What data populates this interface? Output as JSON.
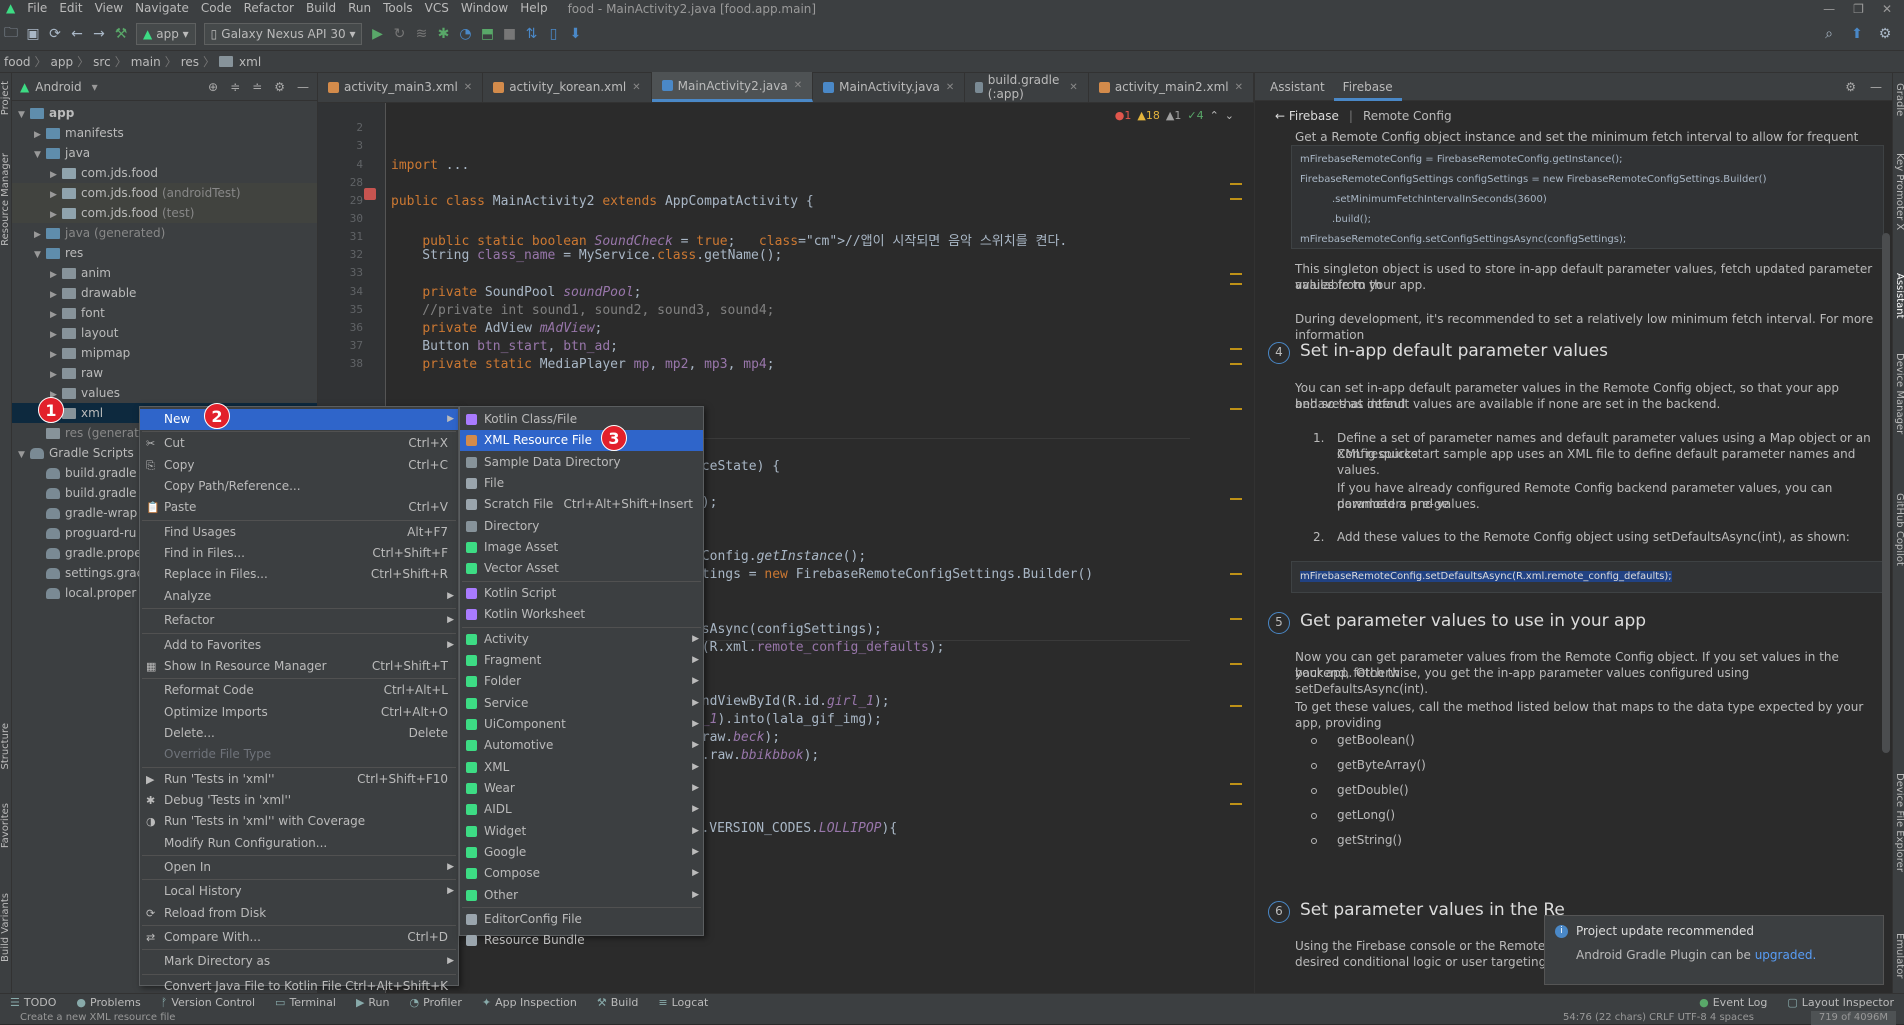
{
  "menubar": {
    "items": [
      "File",
      "Edit",
      "View",
      "Navigate",
      "Code",
      "Refactor",
      "Build",
      "Run",
      "Tools",
      "VCS",
      "Window",
      "Help"
    ],
    "title": "food - MainActivity2.java [food.app.main]"
  },
  "toolbar": {
    "config": "app",
    "device": "Galaxy Nexus API 30"
  },
  "breadcrumb": [
    "food",
    "app",
    "src",
    "main",
    "res",
    "xml"
  ],
  "project": {
    "view": "Android",
    "tree": [
      {
        "label": "app",
        "depth": 0,
        "arrow": "▼",
        "icon": "folder-blue",
        "bold": true
      },
      {
        "label": "manifests",
        "depth": 1,
        "arrow": "▶",
        "icon": "folder-blue"
      },
      {
        "label": "java",
        "depth": 1,
        "arrow": "▼",
        "icon": "folder-blue"
      },
      {
        "label": "com.jds.food",
        "depth": 2,
        "arrow": "▶",
        "icon": "pkg"
      },
      {
        "label": "com.jds.food",
        "suffix": "(androidTest)",
        "depth": 2,
        "arrow": "▶",
        "icon": "pkg",
        "hl": true
      },
      {
        "label": "com.jds.food",
        "suffix": "(test)",
        "depth": 2,
        "arrow": "▶",
        "icon": "pkg",
        "hl": true
      },
      {
        "label": "java (generated)",
        "depth": 1,
        "arrow": "▶",
        "icon": "folder-blue",
        "dim": true
      },
      {
        "label": "res",
        "depth": 1,
        "arrow": "▼",
        "icon": "folder-blue"
      },
      {
        "label": "anim",
        "depth": 2,
        "arrow": "▶",
        "icon": "folder"
      },
      {
        "label": "drawable",
        "depth": 2,
        "arrow": "▶",
        "icon": "folder"
      },
      {
        "label": "font",
        "depth": 2,
        "arrow": "▶",
        "icon": "folder"
      },
      {
        "label": "layout",
        "depth": 2,
        "arrow": "▶",
        "icon": "folder"
      },
      {
        "label": "mipmap",
        "depth": 2,
        "arrow": "▶",
        "icon": "folder"
      },
      {
        "label": "raw",
        "depth": 2,
        "arrow": "▶",
        "icon": "folder"
      },
      {
        "label": "values",
        "depth": 2,
        "arrow": "▶",
        "icon": "folder"
      },
      {
        "label": "xml",
        "depth": 2,
        "arrow": "▶",
        "icon": "folder",
        "sel": true
      },
      {
        "label": "res (generat",
        "depth": 1,
        "arrow": "",
        "icon": "folder",
        "dim": true
      },
      {
        "label": "Gradle Scripts",
        "depth": 0,
        "arrow": "▼",
        "icon": "gradle"
      },
      {
        "label": "build.gradle",
        "depth": 1,
        "arrow": "",
        "icon": "gradle"
      },
      {
        "label": "build.gradle",
        "depth": 1,
        "arrow": "",
        "icon": "gradle"
      },
      {
        "label": "gradle-wrap",
        "depth": 1,
        "arrow": "",
        "icon": "gradle"
      },
      {
        "label": "proguard-ru",
        "depth": 1,
        "arrow": "",
        "icon": "gradle"
      },
      {
        "label": "gradle.prope",
        "depth": 1,
        "arrow": "",
        "icon": "gradle"
      },
      {
        "label": "settings.grac",
        "depth": 1,
        "arrow": "",
        "icon": "gradle"
      },
      {
        "label": "local.proper",
        "depth": 1,
        "arrow": "",
        "icon": "gradle"
      }
    ]
  },
  "editor_tabs": [
    {
      "label": "activity_main3.xml",
      "color": "#d38b4b"
    },
    {
      "label": "activity_korean.xml",
      "color": "#d38b4b"
    },
    {
      "label": "MainActivity2.java",
      "color": "#4a88c7",
      "active": true
    },
    {
      "label": "MainActivity.java",
      "color": "#4a88c7"
    },
    {
      "label": "build.gradle (:app)",
      "color": "#7a8a94"
    },
    {
      "label": "activity_main2.xml",
      "color": "#d38b4b"
    }
  ],
  "inspections": {
    "errors": "1",
    "warnings": "18",
    "weak": "1",
    "ok": "4"
  },
  "line_numbers": [
    "2",
    "3",
    "4",
    "28",
    "29",
    "30",
    "31",
    "32",
    "33",
    "34",
    "35",
    "36",
    "37",
    "38"
  ],
  "code_lines": [
    {
      "text": "import ..."
    },
    {
      "text": "public class MainActivity2 extends AppCompatActivity {"
    },
    {
      "text": "    public static boolean SoundCheck = true;   //앱이 시작되면 음악 스위치를 켠다."
    },
    {
      "text": "    String class_name = MyService.class.getName();"
    },
    {
      "text": "    private SoundPool soundPool;"
    },
    {
      "text": "    //private int sound1, sound2, sound3, sound4;"
    },
    {
      "text": "    private AdView mAdView;"
    },
    {
      "text": "    Button btn_start, btn_ad;"
    },
    {
      "text": "    private static MediaPlayer mp, mp2, mp3, mp4;"
    },
    {
      "text": "Config;"
    },
    {
      "text": "dInstanceState) {"
    },
    {
      "text": "te);"
    },
    {
      "text": "y_main2);"
    },
    {
      "text": "eRemoteConfig.getInstance();"
    },
    {
      "text": "nfigSettings = new FirebaseRemoteConfigSettings.Builder()"
    },
    {
      "text": "SettingsAsync(configSettings);"
    },
    {
      "text": "tsAsync(R.xml.remote_config_defaults);"
    },
    {
      "text": "View)findViewById(R.id.girl_1);"
    },
    {
      "text": "raw.two_1).into(lala_gif_img);"
    },
    {
      "text": "this,R.raw.beck);"
    },
    {
      "text": " this,R.raw.bbikbbok);"
    },
    {
      "text": "f(Build.VERSION.SDK_INT >= Build.VERSION_CODES.LOLLIPOP){"
    }
  ],
  "assistant": {
    "tabs": [
      "Assistant",
      "Firebase"
    ],
    "back_label": "← Firebase",
    "nav_current": "Remote Config",
    "intro": "Get a Remote Config object instance and set the minimum fetch interval to allow for frequent refreshes:",
    "code1": [
      "mFirebaseRemoteConfig = FirebaseRemoteConfig.getInstance();",
      "FirebaseRemoteConfigSettings configSettings = new FirebaseRemoteConfigSettings.Builder()",
      ".setMinimumFetchIntervalInSeconds(3600)",
      ".build();",
      "mFirebaseRemoteConfig.setConfigSettingsAsync(configSettings);"
    ],
    "p1": "This singleton object is used to store in-app default parameter values, fetch updated parameter values from th",
    "p1b": "available to your app.",
    "p2": "During development, it's recommended to set a relatively low minimum fetch interval. For more information",
    "step4_num": "4",
    "step4_title": "Set in-app default parameter values",
    "p3": "You can set in-app default parameter values in the Remote Config object, so that your app behaves as intend",
    "p3b": "and so that default values are available if none are set in the backend.",
    "li1_num": "1.",
    "li1": "Define a set of parameter names and default parameter values using a Map object or an XML resource",
    "li1b": "Config quickstart sample app uses an XML file to define default parameter names and values.",
    "li1c": "If you have already configured Remote Config backend parameter values, you can download a pre-ge",
    "li1d": "parameters and values.",
    "li2_num": "2.",
    "li2": "Add these values to the Remote Config object using setDefaultsAsync(int), as shown:",
    "code2": "mFirebaseRemoteConfig.setDefaultsAsync(R.xml.remote_config_defaults);",
    "step5_num": "5",
    "step5_title": "Get parameter values to use in your app",
    "p4": "Now you can get parameter values from the Remote Config object. If you set values in the backend, fetch th",
    "p4b": "your app. Otherwise, you get the in-app parameter values configured using setDefaultsAsync(int).",
    "p5": "To get these values, call the method listed below that maps to the data type expected by your app, providing",
    "methods": [
      "getBoolean()",
      "getByteArray()",
      "getDouble()",
      "getLong()",
      "getString()"
    ],
    "step6_num": "6",
    "step6_title": "Set parameter values in the Re",
    "p6": "Using the Firebase console or the Remote Cor",
    "p6b": "desired conditional logic or user targeting."
  },
  "notification": {
    "title": "Project update recommended",
    "body": "Android Gradle Plugin can be",
    "link": "upgraded."
  },
  "context_menu": [
    {
      "label": "New",
      "sub": true,
      "hi": true
    },
    {
      "sep": true
    },
    {
      "label": "Cut",
      "sc": "Ctrl+X",
      "icon": "scissors-icon"
    },
    {
      "label": "Copy",
      "sc": "Ctrl+C",
      "icon": "copy-icon"
    },
    {
      "label": "Copy Path/Reference..."
    },
    {
      "label": "Paste",
      "sc": "Ctrl+V",
      "icon": "paste-icon"
    },
    {
      "sep": true
    },
    {
      "label": "Find Usages",
      "sc": "Alt+F7"
    },
    {
      "label": "Find in Files...",
      "sc": "Ctrl+Shift+F"
    },
    {
      "label": "Replace in Files...",
      "sc": "Ctrl+Shift+R"
    },
    {
      "label": "Analyze",
      "sub": true
    },
    {
      "sep": true
    },
    {
      "label": "Refactor",
      "sub": true
    },
    {
      "sep": true
    },
    {
      "label": "Add to Favorites",
      "sub": true
    },
    {
      "label": "Show In Resource Manager",
      "sc": "Ctrl+Shift+T",
      "icon": "resource-icon"
    },
    {
      "sep": true
    },
    {
      "label": "Reformat Code",
      "sc": "Ctrl+Alt+L"
    },
    {
      "label": "Optimize Imports",
      "sc": "Ctrl+Alt+O"
    },
    {
      "label": "Delete...",
      "sc": "Delete"
    },
    {
      "label": "Override File Type",
      "dis": true
    },
    {
      "sep": true
    },
    {
      "label": "Run 'Tests in 'xml''",
      "sc": "Ctrl+Shift+F10",
      "icon": "run-icon"
    },
    {
      "label": "Debug 'Tests in 'xml''",
      "icon": "debug-icon"
    },
    {
      "label": "Run 'Tests in 'xml'' with Coverage",
      "icon": "coverage-icon"
    },
    {
      "label": "Modify Run Configuration..."
    },
    {
      "sep": true
    },
    {
      "label": "Open In",
      "sub": true
    },
    {
      "sep": true
    },
    {
      "label": "Local History",
      "sub": true
    },
    {
      "label": "Reload from Disk",
      "icon": "reload-icon"
    },
    {
      "sep": true
    },
    {
      "label": "Compare With...",
      "sc": "Ctrl+D",
      "icon": "compare-icon"
    },
    {
      "sep": true
    },
    {
      "label": "Mark Directory as",
      "sub": true
    },
    {
      "sep": true
    },
    {
      "label": "Convert Java File to Kotlin File",
      "sc": "Ctrl+Alt+Shift+K"
    }
  ],
  "new_submenu": [
    {
      "label": "Kotlin Class/File",
      "icon": "kotlin"
    },
    {
      "label": "XML Resource File",
      "icon": "xml",
      "hi": true
    },
    {
      "label": "Sample Data Directory",
      "icon": "folder"
    },
    {
      "label": "File",
      "icon": "file"
    },
    {
      "label": "Scratch File",
      "sc": "Ctrl+Alt+Shift+Insert",
      "icon": "file"
    },
    {
      "label": "Directory",
      "icon": "folder"
    },
    {
      "label": "Image Asset",
      "icon": "android"
    },
    {
      "label": "Vector Asset",
      "icon": "android"
    },
    {
      "sep": true
    },
    {
      "label": "Kotlin Script",
      "icon": "kotlin"
    },
    {
      "label": "Kotlin Worksheet",
      "icon": "kotlin"
    },
    {
      "sep": true
    },
    {
      "label": "Activity",
      "sub": true,
      "icon": "android"
    },
    {
      "label": "Fragment",
      "sub": true,
      "icon": "android"
    },
    {
      "label": "Folder",
      "sub": true,
      "icon": "android"
    },
    {
      "label": "Service",
      "sub": true,
      "icon": "android"
    },
    {
      "label": "UiComponent",
      "sub": true,
      "icon": "android"
    },
    {
      "label": "Automotive",
      "sub": true,
      "icon": "android"
    },
    {
      "label": "XML",
      "sub": true,
      "icon": "android"
    },
    {
      "label": "Wear",
      "sub": true,
      "icon": "android"
    },
    {
      "label": "AIDL",
      "sub": true,
      "icon": "android"
    },
    {
      "label": "Widget",
      "sub": true,
      "icon": "android"
    },
    {
      "label": "Google",
      "sub": true,
      "icon": "android"
    },
    {
      "label": "Compose",
      "sub": true,
      "icon": "android"
    },
    {
      "label": "Other",
      "sub": true,
      "icon": "android"
    },
    {
      "sep": true
    },
    {
      "label": "EditorConfig File",
      "icon": "gear"
    },
    {
      "label": "Resource Bundle",
      "icon": "file"
    }
  ],
  "badges": [
    "1",
    "2",
    "3"
  ],
  "bottom_tabs": [
    {
      "label": "TODO",
      "icon": "☰"
    },
    {
      "label": "Problems",
      "icon": "●"
    },
    {
      "label": "Version Control",
      "icon": "ᚠ"
    },
    {
      "label": "Terminal",
      "icon": "▭"
    },
    {
      "label": "Run",
      "icon": "▶"
    },
    {
      "label": "Profiler",
      "icon": "◔"
    },
    {
      "label": "App Inspection",
      "icon": "✦"
    },
    {
      "label": "Build",
      "icon": "⚒"
    },
    {
      "label": "Logcat",
      "icon": "≡"
    }
  ],
  "bottom_right_tabs": [
    {
      "label": "Event Log"
    },
    {
      "label": "Layout Inspector"
    }
  ],
  "status_text": "Create a new XML resource file",
  "status_right": "54:76 (22 chars)   CRLF   UTF-8   4 spaces",
  "memory": "719 of 4096M",
  "left_strip": [
    "Project",
    "Resource Manager",
    "Structure",
    "Favorites",
    "Build Variants"
  ],
  "right_strip": [
    "Gradle",
    "Key Promoter X",
    "Assistant",
    "Device Manager",
    "GitHub Copilot",
    "Device File Explorer",
    "Emulator"
  ]
}
